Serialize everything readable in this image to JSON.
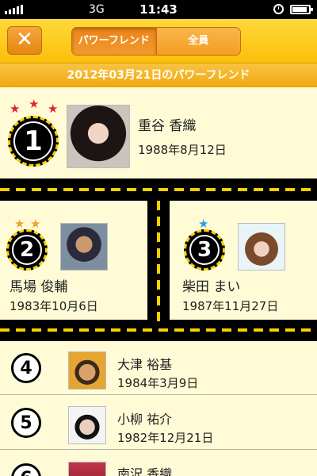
{
  "status_bar": {
    "carrier": "3G",
    "time": "11:43"
  },
  "nav": {
    "close_icon": "close-icon",
    "segments": [
      {
        "label": "パワーフレンド",
        "active": true
      },
      {
        "label": "全員",
        "active": false
      }
    ]
  },
  "banner": {
    "text": "2012年03月21日のパワーフレンド"
  },
  "colors": {
    "accent": "#f7a21b",
    "road": "#000000",
    "road_line": "#f7d100",
    "background": "#fffbd6"
  },
  "top": [
    {
      "rank": "1",
      "stars": 3,
      "star_color": "#e8202a",
      "name": "重谷 香織",
      "birthday": "1988年8月12日"
    },
    {
      "rank": "2",
      "stars": 2,
      "star_color": "#f0a030",
      "name": "馬場 俊輔",
      "birthday": "1983年10月6日"
    },
    {
      "rank": "3",
      "stars": 1,
      "star_color": "#2f9be0",
      "name": "柴田 まい",
      "birthday": "1987年11月27日"
    }
  ],
  "list": [
    {
      "rank": "4",
      "name": "大津 裕基",
      "birthday": "1984年3月9日"
    },
    {
      "rank": "5",
      "name": "小柳 祐介",
      "birthday": "1982年12月21日"
    },
    {
      "rank": "6",
      "name": "南沢 香織",
      "birthday": ""
    }
  ]
}
